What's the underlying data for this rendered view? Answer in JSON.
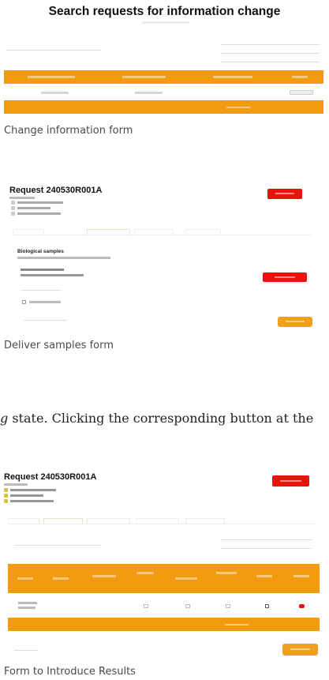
{
  "figure1": {
    "title": "Search requests for information change",
    "caption": "Change information form"
  },
  "figure2": {
    "request_title": "Request 240530R001A",
    "caption": "Deliver samples form",
    "section_title": "Biological samples"
  },
  "body_text": "g state. Clicking the corresponding button at the",
  "figure3": {
    "request_title": "Request 240530R001A",
    "caption": "Form to Introduce Results"
  },
  "colors": {
    "orange": "#f29a10",
    "red": "#e8140c",
    "caption_gray": "#4a4a4a"
  }
}
